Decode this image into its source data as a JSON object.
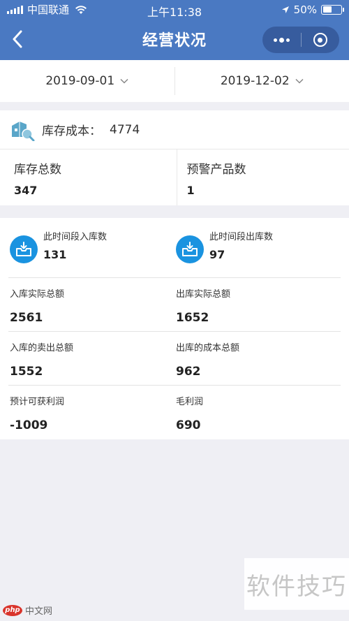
{
  "status": {
    "carrier": "中国联通",
    "time": "上午11:38",
    "battery": "50%",
    "battery_level": 0.5
  },
  "nav": {
    "title": "经营状况"
  },
  "dates": {
    "start": "2019-09-01",
    "end": "2019-12-02"
  },
  "inventory": {
    "cost_label": "库存成本：",
    "cost_value": "4774",
    "total_label": "库存总数",
    "total_value": "347",
    "warning_label": "预警产品数",
    "warning_value": "1"
  },
  "flow": {
    "in_count_label": "此时间段入库数",
    "in_count_value": "131",
    "out_count_label": "此时间段出库数",
    "out_count_value": "97",
    "rows": [
      {
        "left_label": "入库实际总额",
        "left_value": "2561",
        "right_label": "出库实际总额",
        "right_value": "1652"
      },
      {
        "left_label": "入库的卖出总额",
        "left_value": "1552",
        "right_label": "出库的成本总额",
        "right_value": "962"
      },
      {
        "left_label": "预计可获利润",
        "left_value": "-1009",
        "right_label": "毛利润",
        "right_value": "690"
      }
    ]
  },
  "watermark": {
    "right_text": "软件技巧",
    "left_logo": "php",
    "left_text": "中文网"
  },
  "colors": {
    "header": "#4a79c2",
    "icon_blue": "#1a93e0",
    "background": "#efeff4"
  }
}
